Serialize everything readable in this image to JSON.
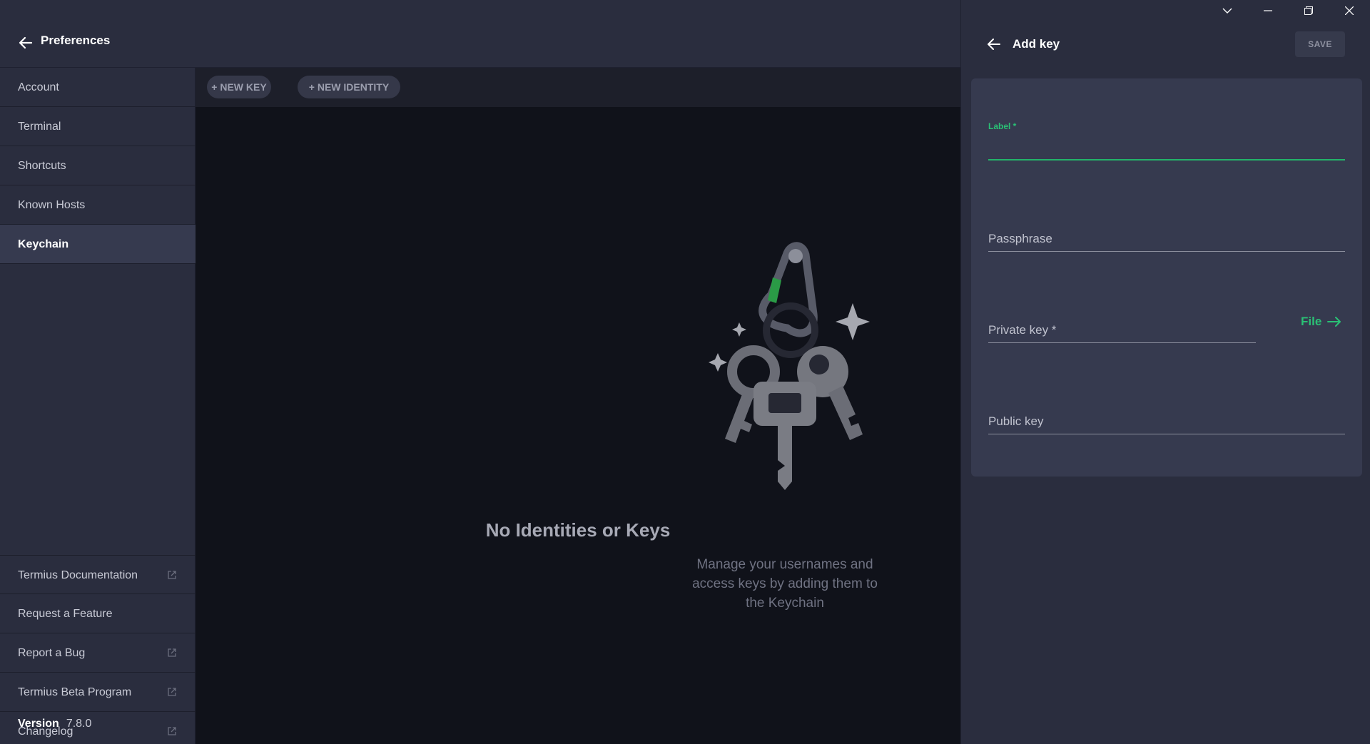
{
  "header": {
    "title": "Preferences"
  },
  "sidebar": {
    "items": [
      {
        "label": "Account"
      },
      {
        "label": "Terminal"
      },
      {
        "label": "Shortcuts"
      },
      {
        "label": "Known Hosts"
      },
      {
        "label": "Keychain",
        "active": true
      }
    ],
    "links": [
      {
        "label": "Termius Documentation",
        "external": true
      },
      {
        "label": "Request a Feature",
        "external": false
      },
      {
        "label": "Report a Bug",
        "external": true
      },
      {
        "label": "Termius Beta Program",
        "external": true
      },
      {
        "label": "Changelog",
        "external": true
      }
    ],
    "version_label": "Version",
    "version_value": "7.8.0"
  },
  "toolbar": {
    "new_key": "+ NEW KEY",
    "new_identity": "+ NEW IDENTITY"
  },
  "empty_state": {
    "title": "No Identities or Keys",
    "description": "Manage your usernames and access keys by adding them to the Keychain"
  },
  "panel": {
    "title": "Add key",
    "save": "SAVE",
    "fields": {
      "label": "Label *",
      "passphrase": "Passphrase",
      "private_key": "Private key *",
      "public_key": "Public key"
    },
    "file_button": "File"
  },
  "colors": {
    "accent": "#2ac075",
    "sidebar_bg": "#2a2d3e",
    "main_bg": "#10121a",
    "card_bg": "#363a4f"
  },
  "icons": {
    "window": [
      "chevron-down-icon",
      "minimize-icon",
      "restore-icon",
      "close-icon"
    ]
  }
}
